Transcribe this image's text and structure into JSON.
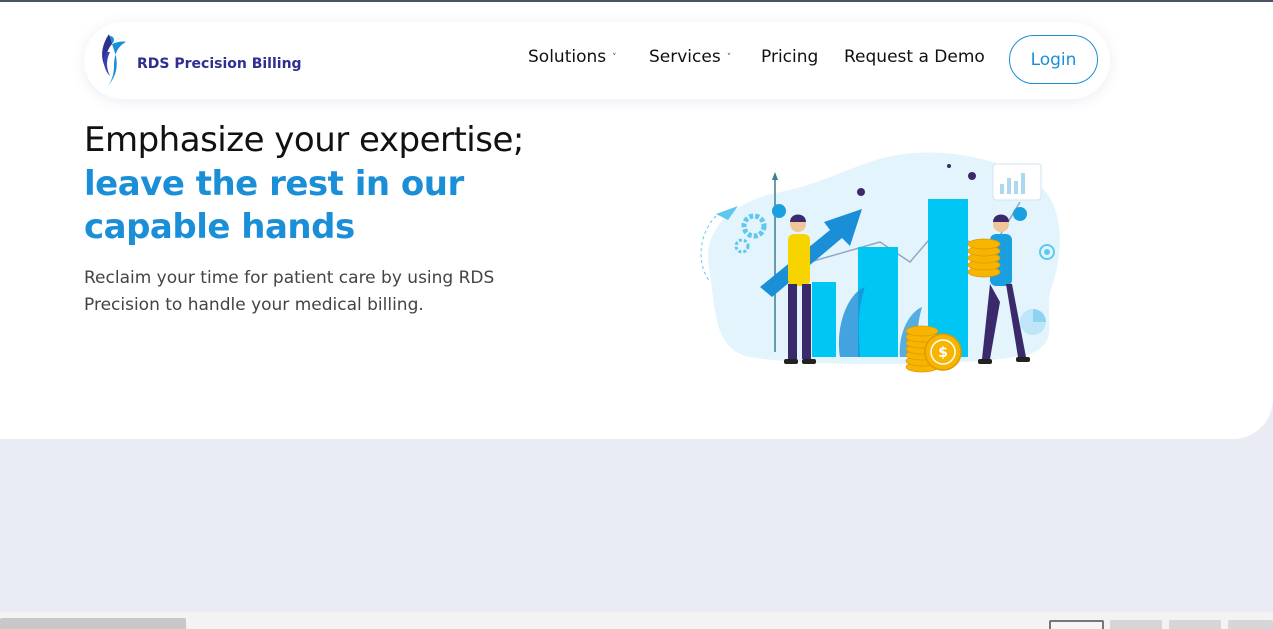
{
  "brand": {
    "name": "RDS Precision Billing",
    "colors": {
      "primary": "#1a8fd8",
      "navy": "#2e2f8f",
      "accent": "#00c6f4"
    }
  },
  "nav": {
    "items": [
      {
        "label": "Solutions",
        "has_dropdown": true
      },
      {
        "label": "Services",
        "has_dropdown": true
      },
      {
        "label": "Pricing",
        "has_dropdown": false
      },
      {
        "label": "Request a Demo",
        "has_dropdown": false
      }
    ],
    "login_label": "Login",
    "chevron": "˅"
  },
  "hero": {
    "title_line1": "Emphasize your expertise;",
    "title_line2": "leave the rest in our capable hands",
    "subtitle": "Reclaim your time for patient care by using RDS Precision to handle your medical billing.",
    "illustration_icon": "growth-chart-coins-illustration"
  }
}
